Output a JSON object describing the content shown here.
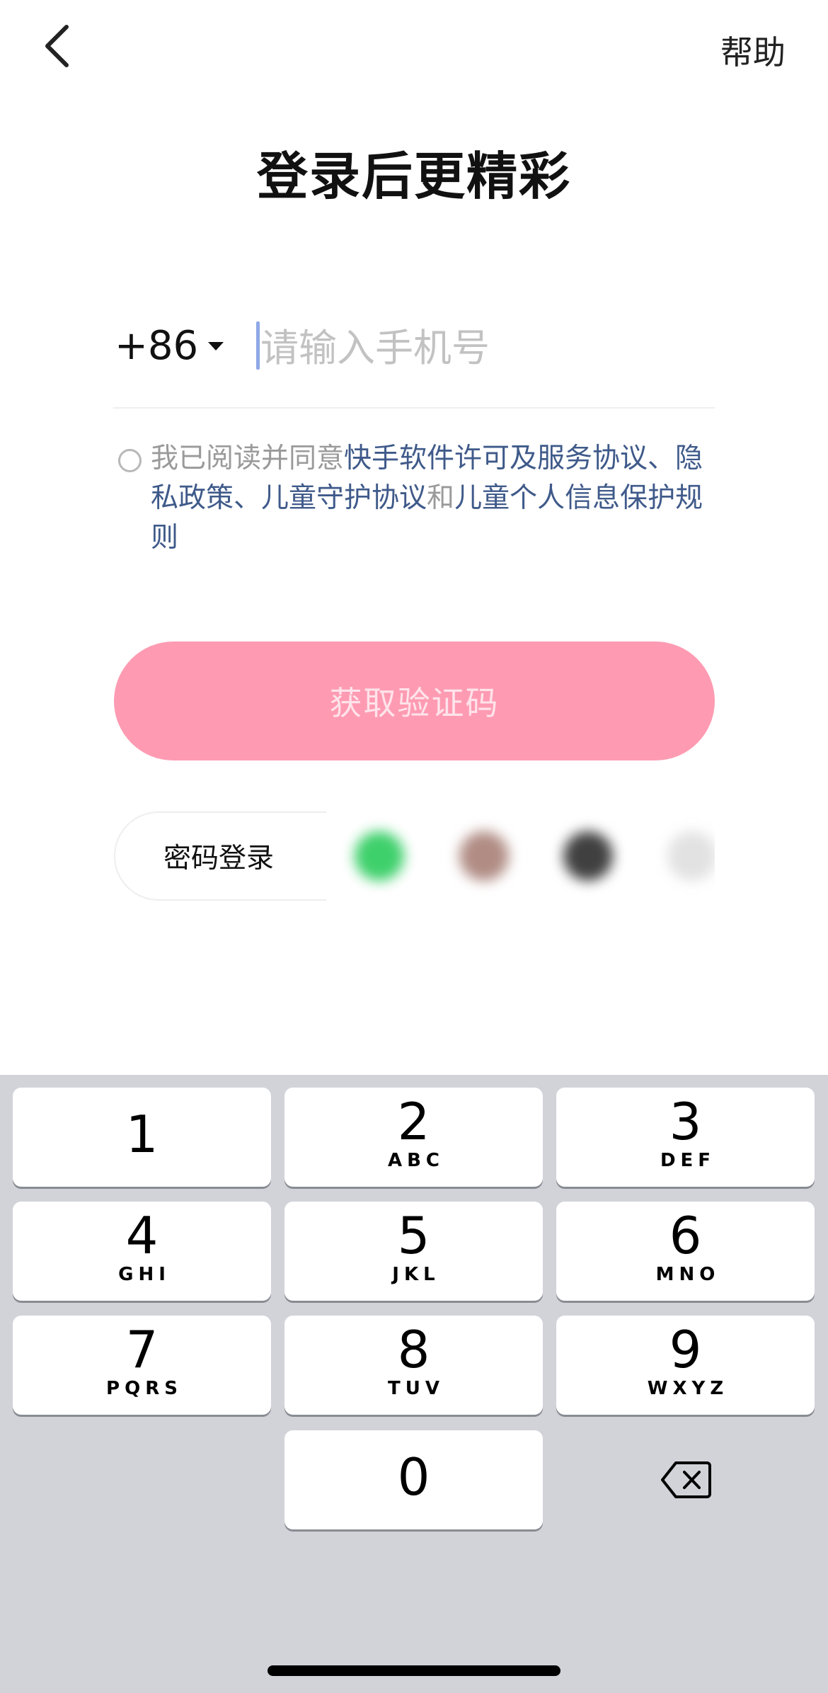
{
  "header": {
    "back_icon": "chevron-left-icon",
    "help_label": "帮助"
  },
  "title": "登录后更精彩",
  "phone": {
    "country_code": "+86",
    "value": "",
    "placeholder": "请输入手机号"
  },
  "agreement": {
    "checked": false,
    "prefix": "我已阅读并同意",
    "link_software": "快手软件许可及服务协议",
    "sep1": "、",
    "link_privacy": "隐私政策",
    "sep2": "、",
    "link_child_protection": "儿童守护协议",
    "conj": "和",
    "link_child_info": "儿童个人信息保护规则"
  },
  "actions": {
    "get_code_label": "获取验证码",
    "password_login_label": "密码登录",
    "social_icons": [
      "wechat-icon",
      "qq-icon",
      "weibo-icon",
      "more-login-icon"
    ]
  },
  "colors": {
    "primary_disabled": "#fe9bb2",
    "link": "#3f5a8a",
    "keyboard_bg": "#d2d3d9"
  },
  "keypad": {
    "k1": {
      "digit": "1",
      "letters": ""
    },
    "k2": {
      "digit": "2",
      "letters": "ABC"
    },
    "k3": {
      "digit": "3",
      "letters": "DEF"
    },
    "k4": {
      "digit": "4",
      "letters": "GHI"
    },
    "k5": {
      "digit": "5",
      "letters": "JKL"
    },
    "k6": {
      "digit": "6",
      "letters": "MNO"
    },
    "k7": {
      "digit": "7",
      "letters": "PQRS"
    },
    "k8": {
      "digit": "8",
      "letters": "TUV"
    },
    "k9": {
      "digit": "9",
      "letters": "WXYZ"
    },
    "k0": {
      "digit": "0",
      "letters": ""
    },
    "delete_icon": "backspace-icon"
  }
}
